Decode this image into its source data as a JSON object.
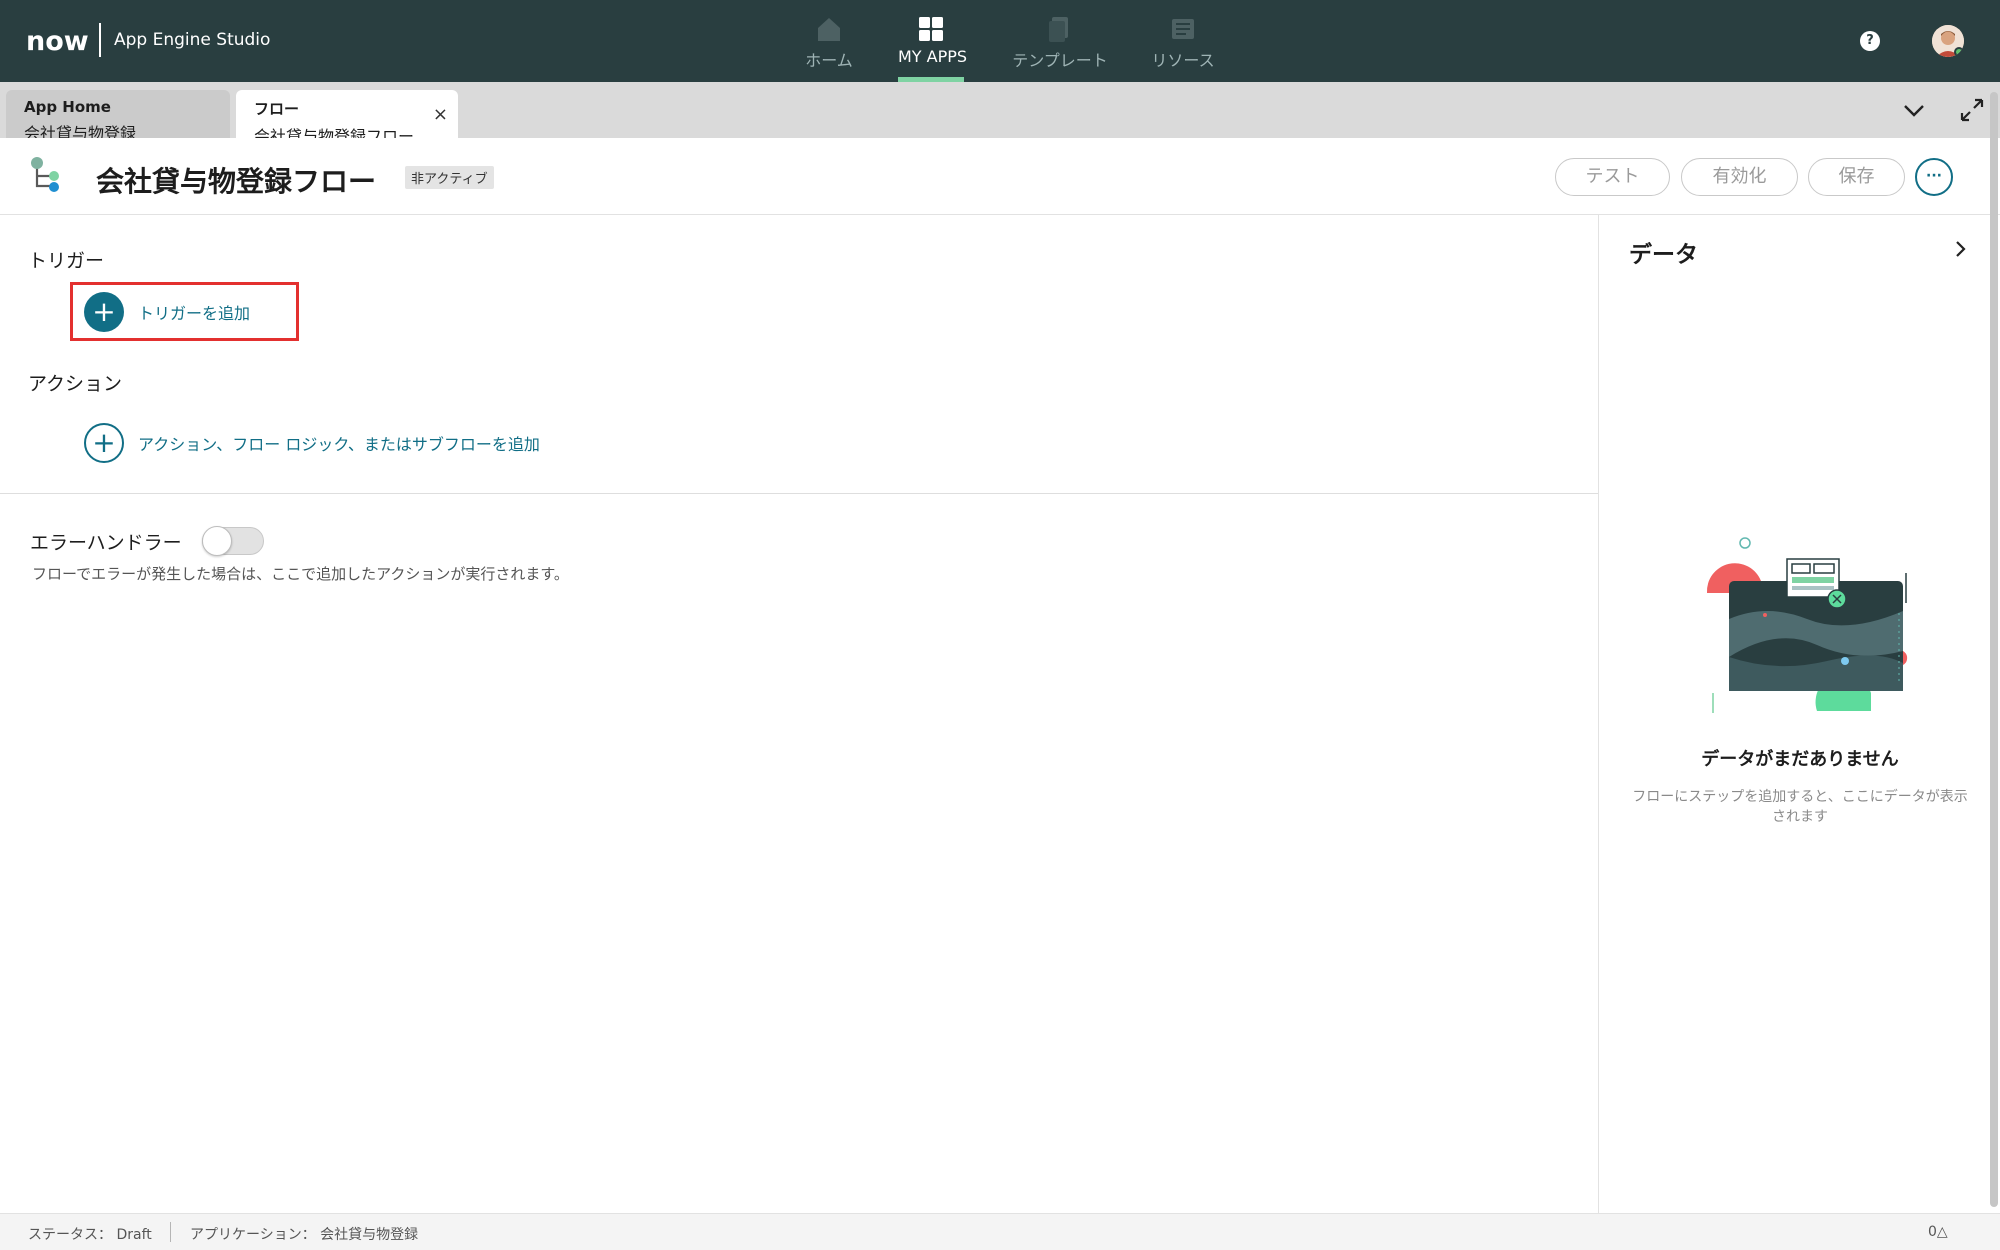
{
  "brand": {
    "logo": "now",
    "product": "App Engine Studio"
  },
  "nav": [
    {
      "label": "ホーム",
      "icon": "home-icon",
      "active": false
    },
    {
      "label": "MY APPS",
      "icon": "grid-icon",
      "active": true
    },
    {
      "label": "テンプレート",
      "icon": "template-icon",
      "active": false
    },
    {
      "label": "リソース",
      "icon": "resources-icon",
      "active": false
    }
  ],
  "help_label": "?",
  "tabs": [
    {
      "title": "App Home",
      "subtitle": "会社貸与物登録"
    },
    {
      "title": "フロー",
      "subtitle": "会社貸与物登録フロー",
      "close": "×"
    }
  ],
  "header": {
    "title": "会社貸与物登録フロー",
    "status": "非アクティブ",
    "buttons": {
      "test": "テスト",
      "activate": "有効化",
      "save": "保存"
    },
    "more": "···"
  },
  "main": {
    "trigger_label": "トリガー",
    "add_trigger": "トリガーを追加",
    "action_label": "アクション",
    "add_action": "アクション、フロー ロジック、またはサブフローを追加",
    "error_handler_label": "エラーハンドラー",
    "error_handler_desc": "フローでエラーが発生した場合は、ここで追加したアクションが実行されます。",
    "plus": "+"
  },
  "data_panel": {
    "title": "データ",
    "empty_title": "データがまだありません",
    "empty_desc": "フローにステップを追加すると、ここにデータが表示されます"
  },
  "status_bar": {
    "status": "ステータス： Draft",
    "application": "アプリケーション： 会社貸与物登録",
    "notifications": "0△"
  },
  "colors": {
    "topbar": "#293e40",
    "accent": "#116e86",
    "highlight": "#e3302f",
    "active_underline": "#7fd3a3"
  }
}
